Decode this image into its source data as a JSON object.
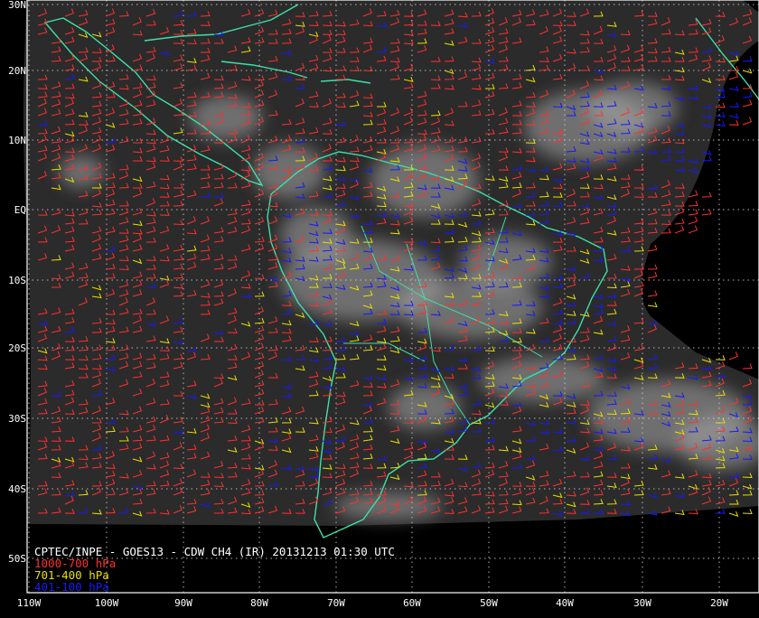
{
  "map": {
    "caption": "CPTEC/INPE - GOES13 - CDW CH4 (IR) 20131213 01:30 UTC",
    "legend": [
      {
        "label": "1000-700 hPa",
        "color": "#ff3030"
      },
      {
        "label": "701-400 hPa",
        "color": "#e8e000"
      },
      {
        "label": "401-100 hPa",
        "color": "#1818ff"
      }
    ],
    "lat_labels": [
      "30N",
      "20N",
      "10N",
      "EQ",
      "10S",
      "20S",
      "30S",
      "40S",
      "50S"
    ],
    "lon_labels": [
      "110W",
      "100W",
      "90W",
      "80W",
      "70W",
      "60W",
      "50W",
      "40W",
      "30W",
      "20W"
    ],
    "grid": "dotted",
    "coastline_color": "#3ee0a8",
    "background": "GOES13 infrared satellite imagery"
  }
}
